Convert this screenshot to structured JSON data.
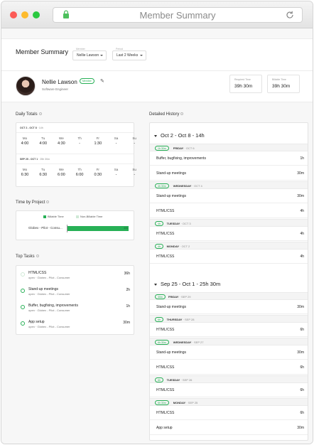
{
  "browser": {
    "title": "Member Summary"
  },
  "header": {
    "title": "Member Summary",
    "member_label": "Member",
    "member_value": "Nellie Lawson",
    "period_label": "Period",
    "period_value": "Last 2 Weeks"
  },
  "profile": {
    "name": "Nellie Lawson",
    "role": "Software Engineer",
    "badge": "Member",
    "required_label": "Required Time",
    "required_value": "39h 30m",
    "billable_label": "Billable Time",
    "billable_value": "39h 30m"
  },
  "daily_totals": {
    "title": "Daily Totals",
    "weeks": [
      {
        "header_bold": "OCT 2 - OCT 8",
        "header_rest": " · 14h",
        "days": [
          {
            "name": "Mo",
            "value": "4:00"
          },
          {
            "name": "Tu",
            "value": "4:00"
          },
          {
            "name": "We",
            "value": "4:30"
          },
          {
            "name": "Th",
            "value": "-"
          },
          {
            "name": "Fr",
            "value": "1:30"
          },
          {
            "name": "Sa",
            "value": "-"
          },
          {
            "name": "Su",
            "value": "-"
          }
        ]
      },
      {
        "header_bold": "SEP 25 - OCT 1",
        "header_rest": " · 25h 30m",
        "days": [
          {
            "name": "Mo",
            "value": "6:30"
          },
          {
            "name": "Tu",
            "value": "6:30"
          },
          {
            "name": "We",
            "value": "6:00"
          },
          {
            "name": "Th",
            "value": "6:00"
          },
          {
            "name": "Fr",
            "value": "0:30"
          },
          {
            "name": "Sa",
            "value": "-"
          },
          {
            "name": "Su",
            "value": "-"
          }
        ]
      }
    ]
  },
  "time_by_project": {
    "title": "Time by Project",
    "legend_billable": "Billable Time",
    "legend_non_billable": "Non-Billable Time",
    "project_name": "Globex - Pilot - Consu...",
    "bar_value": "40h",
    "billable_fraction": 1.0,
    "colors": {
      "billable": "#27b056",
      "non_billable": "#cfe9d6"
    }
  },
  "top_tasks": {
    "title": "Top Tasks",
    "items": [
      {
        "name": "HTML/CSS",
        "sub": "open · Globex - Pilot - Consumer",
        "value": "36h"
      },
      {
        "name": "Stand-up meetings",
        "sub": "open · Globex - Pilot - Consumer",
        "value": "2h"
      },
      {
        "name": "Buffer, bugfixing, improvements",
        "sub": "open · Globex - Pilot - Consumer",
        "value": "1h"
      },
      {
        "name": "App setup",
        "sub": "open · Globex - Pilot - Consumer",
        "value": "30m"
      }
    ]
  },
  "detailed_history": {
    "title": "Detailed History",
    "weeks": [
      {
        "title": "Oct 2 - Oct 8 - 14h",
        "days": [
          {
            "pill": "1h 30m",
            "day": "FRIDAY",
            "date": " · OCT 6",
            "entries": [
              {
                "name": "Buffer, bugfixing, improvements",
                "value": "1h"
              },
              {
                "name": "Stand-up meetings",
                "value": "30m"
              }
            ]
          },
          {
            "pill": "4h 30m",
            "day": "WEDNESDAY",
            "date": " · OCT 4",
            "entries": [
              {
                "name": "Stand-up meetings",
                "value": "30m"
              },
              {
                "name": "HTML/CSS",
                "value": "4h"
              }
            ]
          },
          {
            "pill": "4h",
            "day": "TUESDAY",
            "date": " · OCT 3",
            "entries": [
              {
                "name": "HTML/CSS",
                "value": "4h"
              }
            ]
          },
          {
            "pill": "4h",
            "day": "MONDAY",
            "date": " · OCT 2",
            "entries": [
              {
                "name": "HTML/CSS",
                "value": "4h"
              }
            ]
          }
        ]
      },
      {
        "title": "Sep 25 - Oct 1 - 25h 30m",
        "days": [
          {
            "pill": "30m",
            "day": "FRIDAY",
            "date": " · SEP 29",
            "entries": [
              {
                "name": "Stand-up meetings",
                "value": "30m"
              }
            ]
          },
          {
            "pill": "6h",
            "day": "THURSDAY",
            "date": " · SEP 28",
            "entries": [
              {
                "name": "HTML/CSS",
                "value": "6h"
              }
            ]
          },
          {
            "pill": "6h 30m",
            "day": "WEDNESDAY",
            "date": " · SEP 27",
            "entries": [
              {
                "name": "Stand-up meetings",
                "value": "30m"
              },
              {
                "name": "HTML/CSS",
                "value": "6h"
              }
            ]
          },
          {
            "pill": "6h",
            "day": "TUESDAY",
            "date": " · SEP 26",
            "entries": [
              {
                "name": "HTML/CSS",
                "value": "6h"
              }
            ]
          },
          {
            "pill": "6h 30m",
            "day": "MONDAY",
            "date": " · SEP 25",
            "entries": [
              {
                "name": "HTML/CSS",
                "value": "6h"
              },
              {
                "name": "App setup",
                "value": "30m"
              }
            ]
          }
        ]
      }
    ]
  }
}
